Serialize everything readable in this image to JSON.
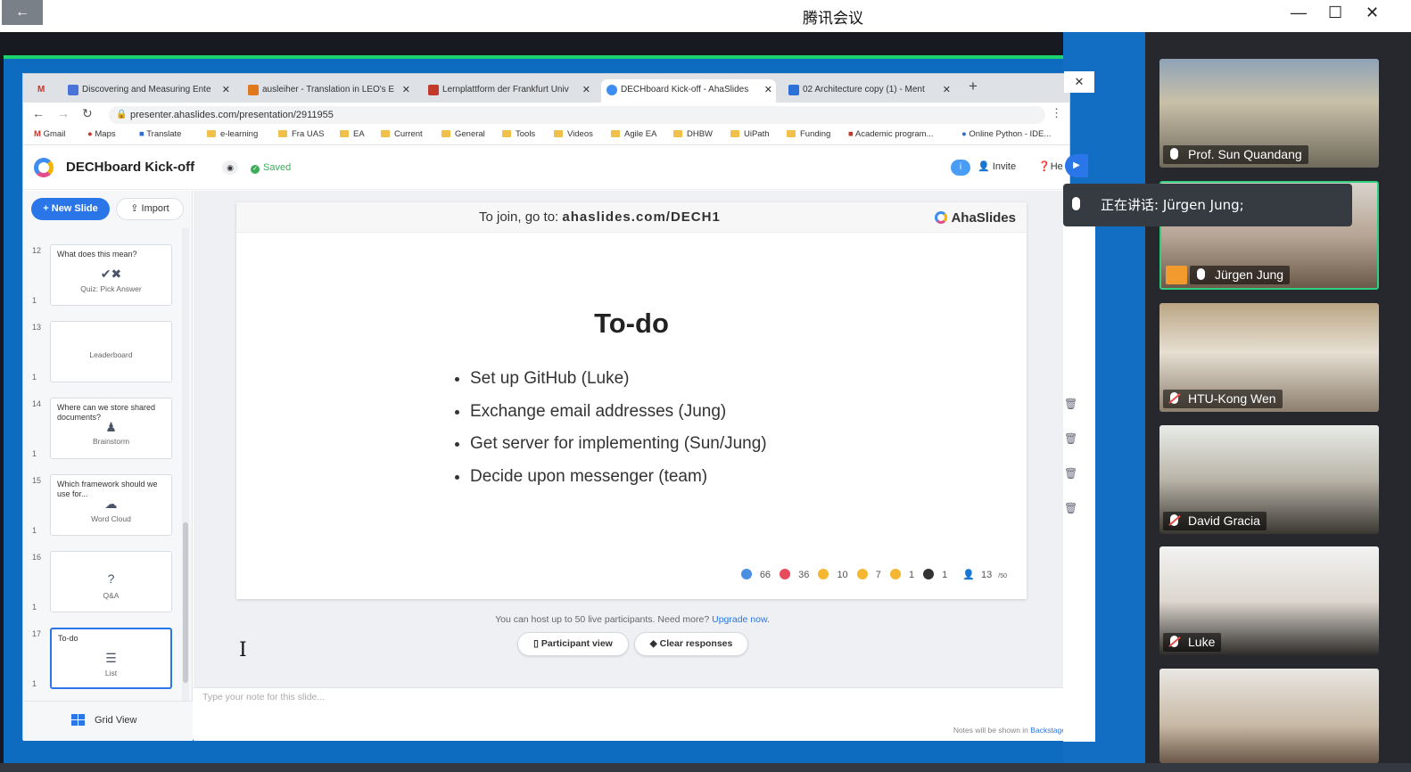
{
  "meeting": {
    "title": "腾讯会议",
    "back_icon": "←",
    "speaking_label": "正在讲话: Jürgen Jung;",
    "participants": [
      {
        "name": "Prof. Sun Quandang",
        "muted": false
      },
      {
        "name": "Jürgen Jung",
        "muted": false
      },
      {
        "name": "HTU-Kong Wen",
        "muted": true
      },
      {
        "name": "David Gracia",
        "muted": true
      },
      {
        "name": "Luke",
        "muted": true
      },
      {
        "name": "",
        "muted": true
      }
    ]
  },
  "browser": {
    "tabs": [
      {
        "label": "Discovering and Measuring Ente",
        "color": "#4a73d9"
      },
      {
        "label": "ausleiher - Translation in LEO's E",
        "color": "#e0791e"
      },
      {
        "label": "Lernplattform der Frankfurt Univ",
        "color": "#c0392b"
      },
      {
        "label": "DECHboard Kick-off - AhaSlides",
        "color": "#3d8ef0"
      },
      {
        "label": "02 Architecture copy (1) - Ment",
        "color": "#2c6fd6"
      }
    ],
    "url": "presenter.ahaslides.com/presentation/2911955",
    "bookmarks": [
      "Gmail",
      "Maps",
      "Translate",
      "e-learning",
      "Fra UAS",
      "EA",
      "Current",
      "General",
      "Tools",
      "Videos",
      "Agile EA",
      "DHBW",
      "UiPath",
      "Funding",
      "Academic program...",
      "Online Python - IDE..."
    ]
  },
  "app": {
    "title": "DECHboard Kick-off",
    "saved": "Saved",
    "invite": "Invite",
    "help": "He",
    "info": "i",
    "new_slide": "+ New Slide",
    "import": "Import",
    "grid_view": "Grid View",
    "slides": [
      {
        "num": "12",
        "title": "What does this mean?",
        "icon": "✔✖",
        "type": "Quiz: Pick Answer",
        "sub": "1"
      },
      {
        "num": "13",
        "title": "",
        "icon": "",
        "type": "Leaderboard",
        "sub": "1"
      },
      {
        "num": "14",
        "title": "Where can we store shared documents?",
        "icon": "♟",
        "type": "Brainstorm",
        "sub": "1"
      },
      {
        "num": "15",
        "title": "Which framework should we use for...",
        "icon": "☁",
        "type": "Word Cloud",
        "sub": "1"
      },
      {
        "num": "16",
        "title": "",
        "icon": "?",
        "type": "Q&A",
        "sub": "1"
      },
      {
        "num": "17",
        "title": "To-do",
        "icon": "☰",
        "type": "List",
        "sub": "1"
      }
    ]
  },
  "slide": {
    "join_prefix": "To join, go to: ",
    "join_url": "ahaslides.com/DECH1",
    "brand": "AhaSlides",
    "heading": "To-do",
    "items": [
      "Set up GitHub (Luke)",
      "Exchange email addresses (Jung)",
      "Get server for implementing (Sun/Jung)",
      "Decide upon messenger (team)"
    ],
    "reactions": {
      "likes": "66",
      "hearts": "36",
      "laughs": "10",
      "wows": "7",
      "sads": "1",
      "questions": "1",
      "audience": "13",
      "audience_max": "/50"
    }
  },
  "footer": {
    "limit_text": "You can host up to 50 live participants. Need more?",
    "upgrade": "Upgrade now.",
    "participant_view": "Participant view",
    "clear_responses": "Clear responses",
    "notes_placeholder": "Type your note for this slide...",
    "notes_foot": "Notes will be shown in",
    "backstage": "Backstage"
  },
  "colors": {
    "accent": "#2a76e8",
    "saved": "#3dae57",
    "speaking": "#2fcf7e",
    "share_frame": "#0e6cc0"
  }
}
